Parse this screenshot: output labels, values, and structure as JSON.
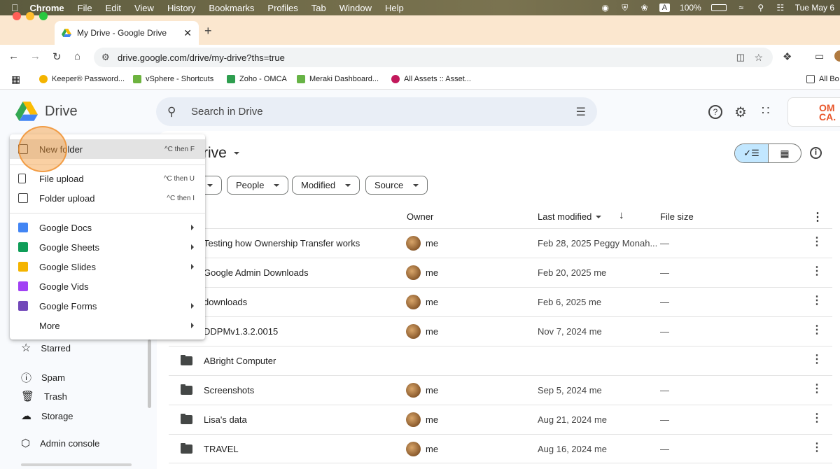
{
  "menubar": {
    "items": [
      "Chrome",
      "File",
      "Edit",
      "View",
      "History",
      "Bookmarks",
      "Profiles",
      "Tab",
      "Window",
      "Help"
    ],
    "battery": "100%",
    "clock": "Tue May 6",
    "input_indicator": "A"
  },
  "browser": {
    "tab_title": "My Drive - Google Drive",
    "url": "drive.google.com/drive/my-drive?ths=true",
    "bookmarks": [
      "Keeper® Password...",
      "vSphere - Shortcuts",
      "Zoho - OMCA",
      "Meraki Dashboard...",
      "All Assets :: Asset...",
      "All Bo"
    ]
  },
  "drive": {
    "app_name": "Drive",
    "search_placeholder": "Search in Drive",
    "page_title": "rive",
    "account_badge": "OM CA.",
    "filters": [
      "People",
      "Modified",
      "Source"
    ],
    "columns": {
      "owner": "Owner",
      "last_modified": "Last modified",
      "file_size": "File size"
    },
    "files": [
      {
        "name": "Testing how Ownership Transfer works",
        "owner": "me",
        "modified": "Feb 28, 2025 Peggy Monah...",
        "size": "—"
      },
      {
        "name": "Google Admin Downloads",
        "owner": "me",
        "modified": "Feb 20, 2025 me",
        "size": "—"
      },
      {
        "name": "downloads",
        "owner": "me",
        "modified": "Feb 6, 2025 me",
        "size": "—"
      },
      {
        "name": "DDPMv1.3.2.0015",
        "owner": "me",
        "modified": "Nov 7, 2024 me",
        "size": "—"
      },
      {
        "name": "ABright Computer",
        "owner": "",
        "modified": "",
        "size": ""
      },
      {
        "name": "Screenshots",
        "owner": "me",
        "modified": "Sep 5, 2024 me",
        "size": "—"
      },
      {
        "name": "Lisa's data",
        "owner": "me",
        "modified": "Aug 21, 2024 me",
        "size": "—"
      },
      {
        "name": "TRAVEL",
        "owner": "me",
        "modified": "Aug 16, 2024 me",
        "size": "—"
      }
    ],
    "sidebar": {
      "starred": "Starred",
      "spam": "Spam",
      "trash": "Trash",
      "storage": "Storage",
      "admin": "Admin console"
    }
  },
  "new_menu": {
    "new_folder": {
      "label": "New folder",
      "shortcut": "^C then F"
    },
    "file_upload": {
      "label": "File upload",
      "shortcut": "^C then U"
    },
    "folder_upload": {
      "label": "Folder upload",
      "shortcut": "^C then I"
    },
    "docs": "Google Docs",
    "sheets": "Google Sheets",
    "slides": "Google Slides",
    "vids": "Google Vids",
    "forms": "Google Forms",
    "more": "More"
  },
  "colors": {
    "docs": "#4285f4",
    "sheets": "#0f9d58",
    "slides": "#f4b400",
    "vids": "#a142f4",
    "forms": "#7248b9",
    "highlight": "#f59632"
  }
}
